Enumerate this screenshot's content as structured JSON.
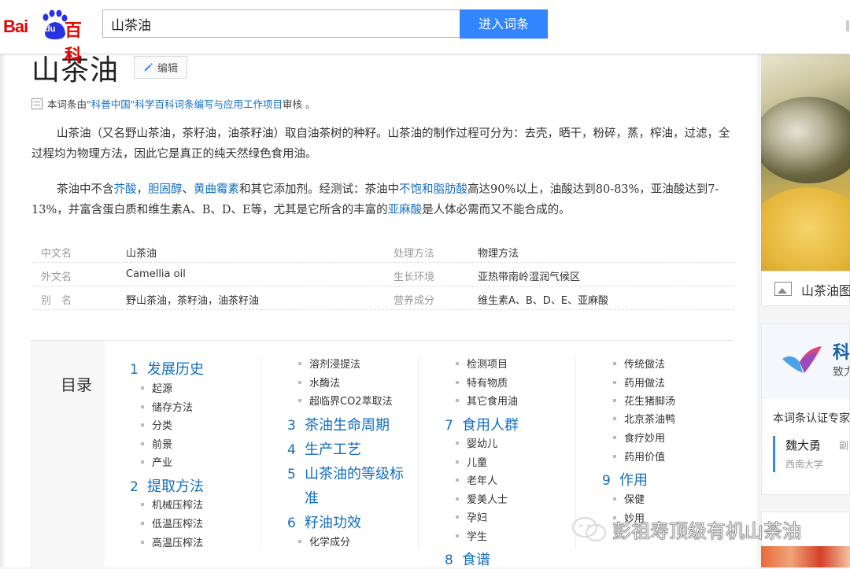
{
  "header": {
    "logo": {
      "text_left": "Bai",
      "text_paw": "du",
      "text_right": "百科"
    },
    "search": {
      "value": "山茶油"
    },
    "submit_label": "进入词条"
  },
  "article": {
    "title": "山茶油",
    "edit_label": "编辑",
    "review": {
      "prefix": "本词条由",
      "link": "\"科普中国\"科学百科词条编写与应用工作项目",
      "suffix": " 审核 。"
    },
    "paragraph1": "山茶油（又名野山茶油，茶籽油，油茶籽油）取自油茶树的种籽。山茶油的制作过程可分为：去壳，晒干，粉碎，蒸，榨油，过滤，全过程均为物理方法，因此它是真正的纯天然绿色食用油。",
    "paragraph2": {
      "t1": "茶油中不含",
      "l1": "芥酸",
      "t2": "，",
      "l2": "胆固醇",
      "t3": "、",
      "l3": "黄曲霉素",
      "t4": "和其它添加剂。经测试：茶油中",
      "l4": "不饱和脂肪酸",
      "t5": "高达90%以上，油酸达到80-83%，亚油酸达到7-13%，并富含蛋白质和维生素A、B、D、E等，尤其是它所含的丰富的",
      "l5": "亚麻酸",
      "t6": "是人体必需而又不能合成的。"
    },
    "basic_info": [
      {
        "k1": "中文名",
        "v1": "山茶油",
        "k2": "处理方法",
        "v2": "物理方法"
      },
      {
        "k1": "外文名",
        "v1": "Camellia oil",
        "k2": "生长环境",
        "v2": "亚热带南岭湿润气候区"
      },
      {
        "k1": "别　名",
        "v1": "野山茶油，茶籽油，油茶籽油",
        "k2": "营养成分",
        "v2": "维生素A、B、D、E、亚麻酸"
      }
    ]
  },
  "catalog": {
    "label": "目录",
    "col1": {
      "s1": {
        "num": "1",
        "title": "发展历史"
      },
      "s1_items": [
        "起源",
        "储存方法",
        "分类",
        "前景",
        "产业"
      ],
      "s2": {
        "num": "2",
        "title": "提取方法"
      },
      "s2_items": [
        "机械压榨法",
        "低温压榨法",
        "高温压榨法"
      ]
    },
    "col2": {
      "items_top": [
        "溶剂浸提法",
        "水酶法",
        "超临界CO2萃取法"
      ],
      "s3": {
        "num": "3",
        "title": "茶油生命周期"
      },
      "s4": {
        "num": "4",
        "title": "生产工艺"
      },
      "s5": {
        "num": "5",
        "title_a": "山茶油的等级标",
        "title_b": "准"
      },
      "s6": {
        "num": "6",
        "title": "籽油功效"
      },
      "s6_items": [
        "化学成分"
      ]
    },
    "col3": {
      "items_top": [
        "检测项目",
        "特有物质",
        "其它食用油"
      ],
      "s7": {
        "num": "7",
        "title": "食用人群"
      },
      "s7_items": [
        "婴幼儿",
        "儿童",
        "老年人",
        "爱美人士",
        "孕妇",
        "学生"
      ],
      "s8": {
        "num": "8",
        "title": "食谱"
      }
    },
    "col4": {
      "items_top": [
        "传统做法",
        "药用做法",
        "花生猪脚汤",
        "北京茶油鸭",
        "食疗妙用",
        "药用价值"
      ],
      "s9": {
        "num": "9",
        "title": "作用"
      },
      "s9_items": [
        "保健",
        "妙用"
      ]
    }
  },
  "sidebar": {
    "image_caption": "山茶油图",
    "card": {
      "title": "科",
      "subtitle": "致力",
      "cert": "本词条认证专家",
      "expert_name": "魏大勇",
      "expert_role": "副",
      "expert_school": "西南大学"
    }
  },
  "watermark": {
    "text": "彭祖寿顶级有机山茶油"
  }
}
